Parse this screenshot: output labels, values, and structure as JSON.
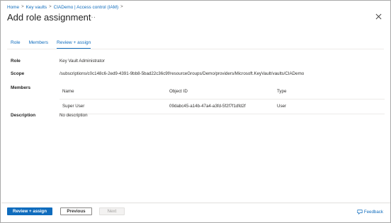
{
  "breadcrumb": {
    "items": [
      "Home",
      "Key vaults",
      "CIADemo | Access control (IAM)"
    ],
    "separator": ">"
  },
  "header": {
    "title": "Add role assignment",
    "more": "···"
  },
  "tabs": [
    {
      "label": "Role",
      "active": false
    },
    {
      "label": "Members",
      "active": false
    },
    {
      "label": "Review + assign",
      "active": true
    }
  ],
  "review": {
    "role_label": "Role",
    "role_value": "Key Vault Administrator",
    "scope_label": "Scope",
    "scope_value": "/subscriptions/c0c148c6-2ed9-4391-9bb8-5bad22c36c9f/resourceGroups/Demo/providers/Microsoft.KeyVault/vaults/CIADemo",
    "members_label": "Members",
    "description_label": "Description",
    "description_value": "No description"
  },
  "members_table": {
    "columns": [
      "Name",
      "Object ID",
      "Type"
    ],
    "rows": [
      {
        "name": "Super User",
        "object_id": "09dabc45-a14b-47a4-a3fd-5f2f7f1dfd2f",
        "type": "User"
      }
    ]
  },
  "footer": {
    "review_assign": "Review + assign",
    "previous": "Previous",
    "next": "Next",
    "feedback": "Feedback"
  },
  "colors": {
    "accent": "#0f6cbd",
    "text": "#323130",
    "disabled": "#a19f9d"
  }
}
